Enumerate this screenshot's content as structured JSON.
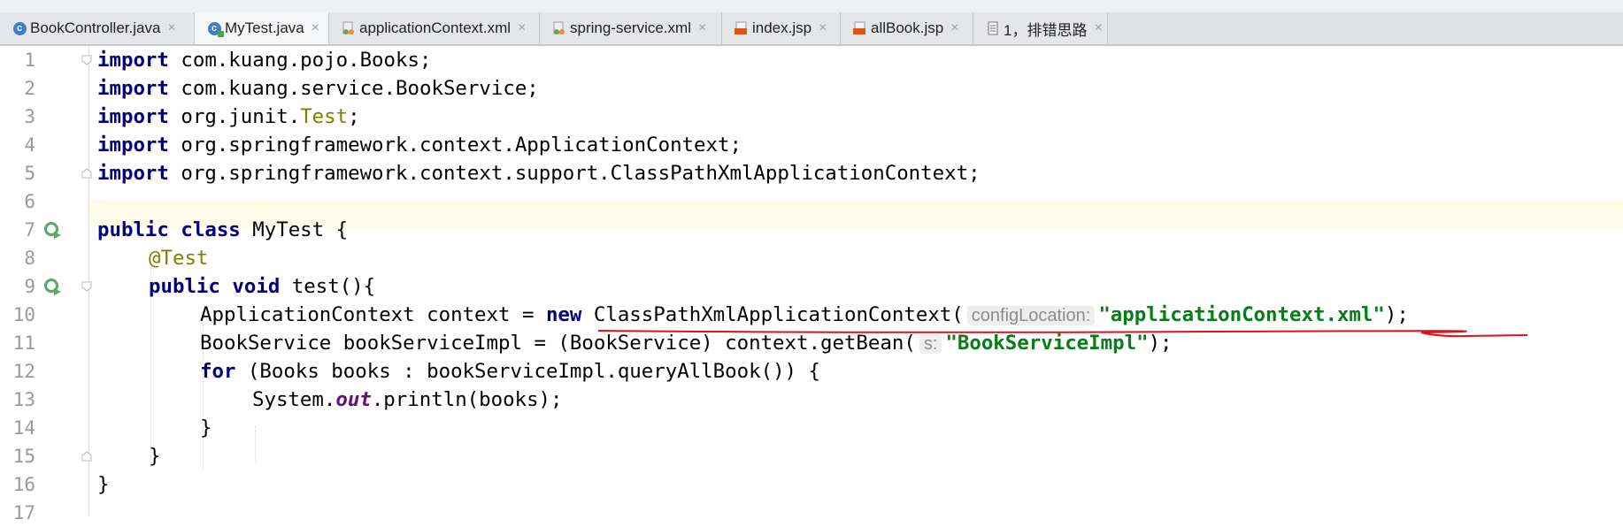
{
  "tabs": [
    {
      "label": "BookController.java",
      "icon": "java-class-icon",
      "active": false
    },
    {
      "label": "MyTest.java",
      "icon": "java-test-class-icon",
      "active": true
    },
    {
      "label": "applicationContext.xml",
      "icon": "spring-xml-icon",
      "active": false
    },
    {
      "label": "spring-service.xml",
      "icon": "spring-xml-icon",
      "active": false
    },
    {
      "label": "index.jsp",
      "icon": "jsp-icon",
      "active": false
    },
    {
      "label": "allBook.jsp",
      "icon": "jsp-icon",
      "active": false
    },
    {
      "label": "1，排错思路",
      "icon": "text-file-icon",
      "active": false
    }
  ],
  "close_glyph": "×",
  "line_numbers": [
    "1",
    "2",
    "3",
    "4",
    "5",
    "6",
    "7",
    "8",
    "9",
    "10",
    "11",
    "12",
    "13",
    "14",
    "15",
    "16",
    "17"
  ],
  "code": {
    "l1": {
      "kw": "import",
      "rest": " com.kuang.pojo.Books;"
    },
    "l2": {
      "kw": "import",
      "rest": " com.kuang.service.BookService;"
    },
    "l3": {
      "kw": "import",
      "pre": " org.junit.",
      "ann": "Test",
      "post": ";"
    },
    "l4": {
      "kw": "import",
      "rest": " org.springframework.context.ApplicationContext;"
    },
    "l5": {
      "kw": "import",
      "rest": " org.springframework.context.support.ClassPathXmlApplicationContext;"
    },
    "l7": {
      "kw1": "public",
      "sp": " ",
      "kw2": "class",
      "rest": " MyTest {"
    },
    "l8": {
      "ann": "@Test"
    },
    "l9": {
      "kw1": "public",
      "sp": " ",
      "kw2": "void",
      "rest": " test(){"
    },
    "l10": {
      "pre": "ApplicationContext context = ",
      "kw": "new",
      "mid": " ClassPathXmlApplicationContext(",
      "hint": "configLocation:",
      "str": "\"applicationContext.xml\"",
      "post": ");"
    },
    "l11": {
      "pre": "BookService bookServiceImpl = (BookService) context.getBean(",
      "hint": "s:",
      "str": "\"BookServiceImpl\"",
      "post": ");"
    },
    "l12": {
      "kw": "for",
      "rest": " (Books books : bookServiceImpl.queryAllBook()) {"
    },
    "l13": {
      "pre": "System.",
      "fld": "out",
      "post": ".println(books);"
    },
    "l14": {
      "rest": "}"
    },
    "l15": {
      "rest": "}"
    },
    "l16": {
      "rest": "}"
    }
  },
  "colors": {
    "keyword": "#000080",
    "annotation": "#808000",
    "string": "#067d17",
    "field": "#660e7a",
    "underline": "#e0101a",
    "current_line": "#fffbe8"
  }
}
